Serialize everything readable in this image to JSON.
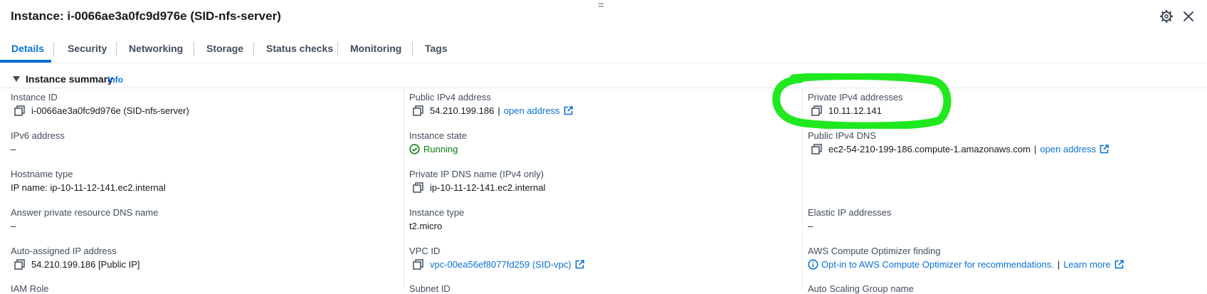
{
  "header": {
    "title": "Instance: i-0066ae3a0fc9d976e (SID-nfs-server)",
    "drag_handle": "=",
    "settings_icon": "gear-icon",
    "close_icon": "close-icon"
  },
  "tabs": [
    {
      "label": "Details",
      "active": true
    },
    {
      "label": "Security"
    },
    {
      "label": "Networking"
    },
    {
      "label": "Storage"
    },
    {
      "label": "Status checks"
    },
    {
      "label": "Monitoring"
    },
    {
      "label": "Tags"
    }
  ],
  "summary": {
    "title": "Instance summary",
    "info_link": "Info"
  },
  "col1": {
    "instance_id_label": "Instance ID",
    "instance_id_value": "i-0066ae3a0fc9d976e (SID-nfs-server)",
    "ipv6_label": "IPv6 address",
    "ipv6_value": "–",
    "hostname_type_label": "Hostname type",
    "hostname_type_value": "IP name: ip-10-11-12-141.ec2.internal",
    "answer_dns_label": "Answer private resource DNS name",
    "answer_dns_value": "–",
    "auto_ip_label": "Auto-assigned IP address",
    "auto_ip_value": "54.210.199.186 [Public IP]",
    "iam_role_label": "IAM Role"
  },
  "col2": {
    "public_ipv4_label": "Public IPv4 address",
    "public_ipv4_value": "54.210.199.186",
    "public_ipv4_sep": "|",
    "public_ipv4_link": "open address",
    "state_label": "Instance state",
    "state_value": "Running",
    "private_dns_label": "Private IP DNS name (IPv4 only)",
    "private_dns_value": "ip-10-11-12-141.ec2.internal",
    "type_label": "Instance type",
    "type_value": "t2.micro",
    "vpc_label": "VPC ID",
    "vpc_value": "vpc-00ea56ef8077fd259 (SID-vpc)",
    "subnet_label": "Subnet ID"
  },
  "col3": {
    "private_ipv4_label": "Private IPv4 addresses",
    "private_ipv4_value": "10.11.12.141",
    "public_dns_label": "Public IPv4 DNS",
    "public_dns_value": "ec2-54-210-199-186.compute-1.amazonaws.com",
    "public_dns_sep": "|",
    "public_dns_link": "open address",
    "elastic_label": "Elastic IP addresses",
    "elastic_value": "–",
    "optimizer_label": "AWS Compute Optimizer finding",
    "optimizer_link": "Opt-in to AWS Compute Optimizer for recommendations.",
    "optimizer_sep": "|",
    "optimizer_learn": "Learn more",
    "asg_label": "Auto Scaling Group name"
  },
  "colors": {
    "link": "#0972d3",
    "running": "#037f0c",
    "highlight": "#1fe81f"
  }
}
